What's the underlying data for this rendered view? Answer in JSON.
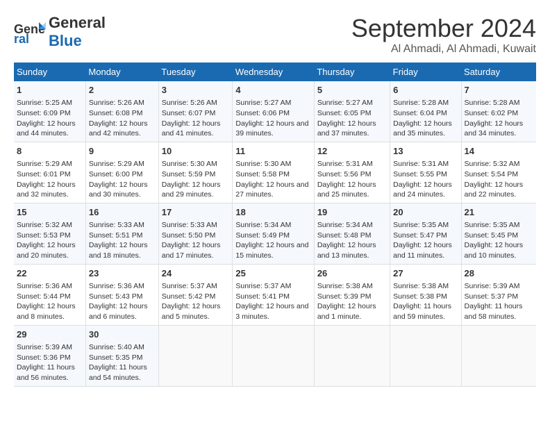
{
  "header": {
    "logo_general": "General",
    "logo_blue": "Blue",
    "month": "September 2024",
    "location": "Al Ahmadi, Al Ahmadi, Kuwait"
  },
  "days_of_week": [
    "Sunday",
    "Monday",
    "Tuesday",
    "Wednesday",
    "Thursday",
    "Friday",
    "Saturday"
  ],
  "weeks": [
    [
      {
        "day": 1,
        "sunrise": "5:25 AM",
        "sunset": "6:09 PM",
        "daylight": "12 hours and 44 minutes."
      },
      {
        "day": 2,
        "sunrise": "5:26 AM",
        "sunset": "6:08 PM",
        "daylight": "12 hours and 42 minutes."
      },
      {
        "day": 3,
        "sunrise": "5:26 AM",
        "sunset": "6:07 PM",
        "daylight": "12 hours and 41 minutes."
      },
      {
        "day": 4,
        "sunrise": "5:27 AM",
        "sunset": "6:06 PM",
        "daylight": "12 hours and 39 minutes."
      },
      {
        "day": 5,
        "sunrise": "5:27 AM",
        "sunset": "6:05 PM",
        "daylight": "12 hours and 37 minutes."
      },
      {
        "day": 6,
        "sunrise": "5:28 AM",
        "sunset": "6:04 PM",
        "daylight": "12 hours and 35 minutes."
      },
      {
        "day": 7,
        "sunrise": "5:28 AM",
        "sunset": "6:02 PM",
        "daylight": "12 hours and 34 minutes."
      }
    ],
    [
      {
        "day": 8,
        "sunrise": "5:29 AM",
        "sunset": "6:01 PM",
        "daylight": "12 hours and 32 minutes."
      },
      {
        "day": 9,
        "sunrise": "5:29 AM",
        "sunset": "6:00 PM",
        "daylight": "12 hours and 30 minutes."
      },
      {
        "day": 10,
        "sunrise": "5:30 AM",
        "sunset": "5:59 PM",
        "daylight": "12 hours and 29 minutes."
      },
      {
        "day": 11,
        "sunrise": "5:30 AM",
        "sunset": "5:58 PM",
        "daylight": "12 hours and 27 minutes."
      },
      {
        "day": 12,
        "sunrise": "5:31 AM",
        "sunset": "5:56 PM",
        "daylight": "12 hours and 25 minutes."
      },
      {
        "day": 13,
        "sunrise": "5:31 AM",
        "sunset": "5:55 PM",
        "daylight": "12 hours and 24 minutes."
      },
      {
        "day": 14,
        "sunrise": "5:32 AM",
        "sunset": "5:54 PM",
        "daylight": "12 hours and 22 minutes."
      }
    ],
    [
      {
        "day": 15,
        "sunrise": "5:32 AM",
        "sunset": "5:53 PM",
        "daylight": "12 hours and 20 minutes."
      },
      {
        "day": 16,
        "sunrise": "5:33 AM",
        "sunset": "5:51 PM",
        "daylight": "12 hours and 18 minutes."
      },
      {
        "day": 17,
        "sunrise": "5:33 AM",
        "sunset": "5:50 PM",
        "daylight": "12 hours and 17 minutes."
      },
      {
        "day": 18,
        "sunrise": "5:34 AM",
        "sunset": "5:49 PM",
        "daylight": "12 hours and 15 minutes."
      },
      {
        "day": 19,
        "sunrise": "5:34 AM",
        "sunset": "5:48 PM",
        "daylight": "12 hours and 13 minutes."
      },
      {
        "day": 20,
        "sunrise": "5:35 AM",
        "sunset": "5:47 PM",
        "daylight": "12 hours and 11 minutes."
      },
      {
        "day": 21,
        "sunrise": "5:35 AM",
        "sunset": "5:45 PM",
        "daylight": "12 hours and 10 minutes."
      }
    ],
    [
      {
        "day": 22,
        "sunrise": "5:36 AM",
        "sunset": "5:44 PM",
        "daylight": "12 hours and 8 minutes."
      },
      {
        "day": 23,
        "sunrise": "5:36 AM",
        "sunset": "5:43 PM",
        "daylight": "12 hours and 6 minutes."
      },
      {
        "day": 24,
        "sunrise": "5:37 AM",
        "sunset": "5:42 PM",
        "daylight": "12 hours and 5 minutes."
      },
      {
        "day": 25,
        "sunrise": "5:37 AM",
        "sunset": "5:41 PM",
        "daylight": "12 hours and 3 minutes."
      },
      {
        "day": 26,
        "sunrise": "5:38 AM",
        "sunset": "5:39 PM",
        "daylight": "12 hours and 1 minute."
      },
      {
        "day": 27,
        "sunrise": "5:38 AM",
        "sunset": "5:38 PM",
        "daylight": "11 hours and 59 minutes."
      },
      {
        "day": 28,
        "sunrise": "5:39 AM",
        "sunset": "5:37 PM",
        "daylight": "11 hours and 58 minutes."
      }
    ],
    [
      {
        "day": 29,
        "sunrise": "5:39 AM",
        "sunset": "5:36 PM",
        "daylight": "11 hours and 56 minutes."
      },
      {
        "day": 30,
        "sunrise": "5:40 AM",
        "sunset": "5:35 PM",
        "daylight": "11 hours and 54 minutes."
      },
      null,
      null,
      null,
      null,
      null
    ]
  ]
}
